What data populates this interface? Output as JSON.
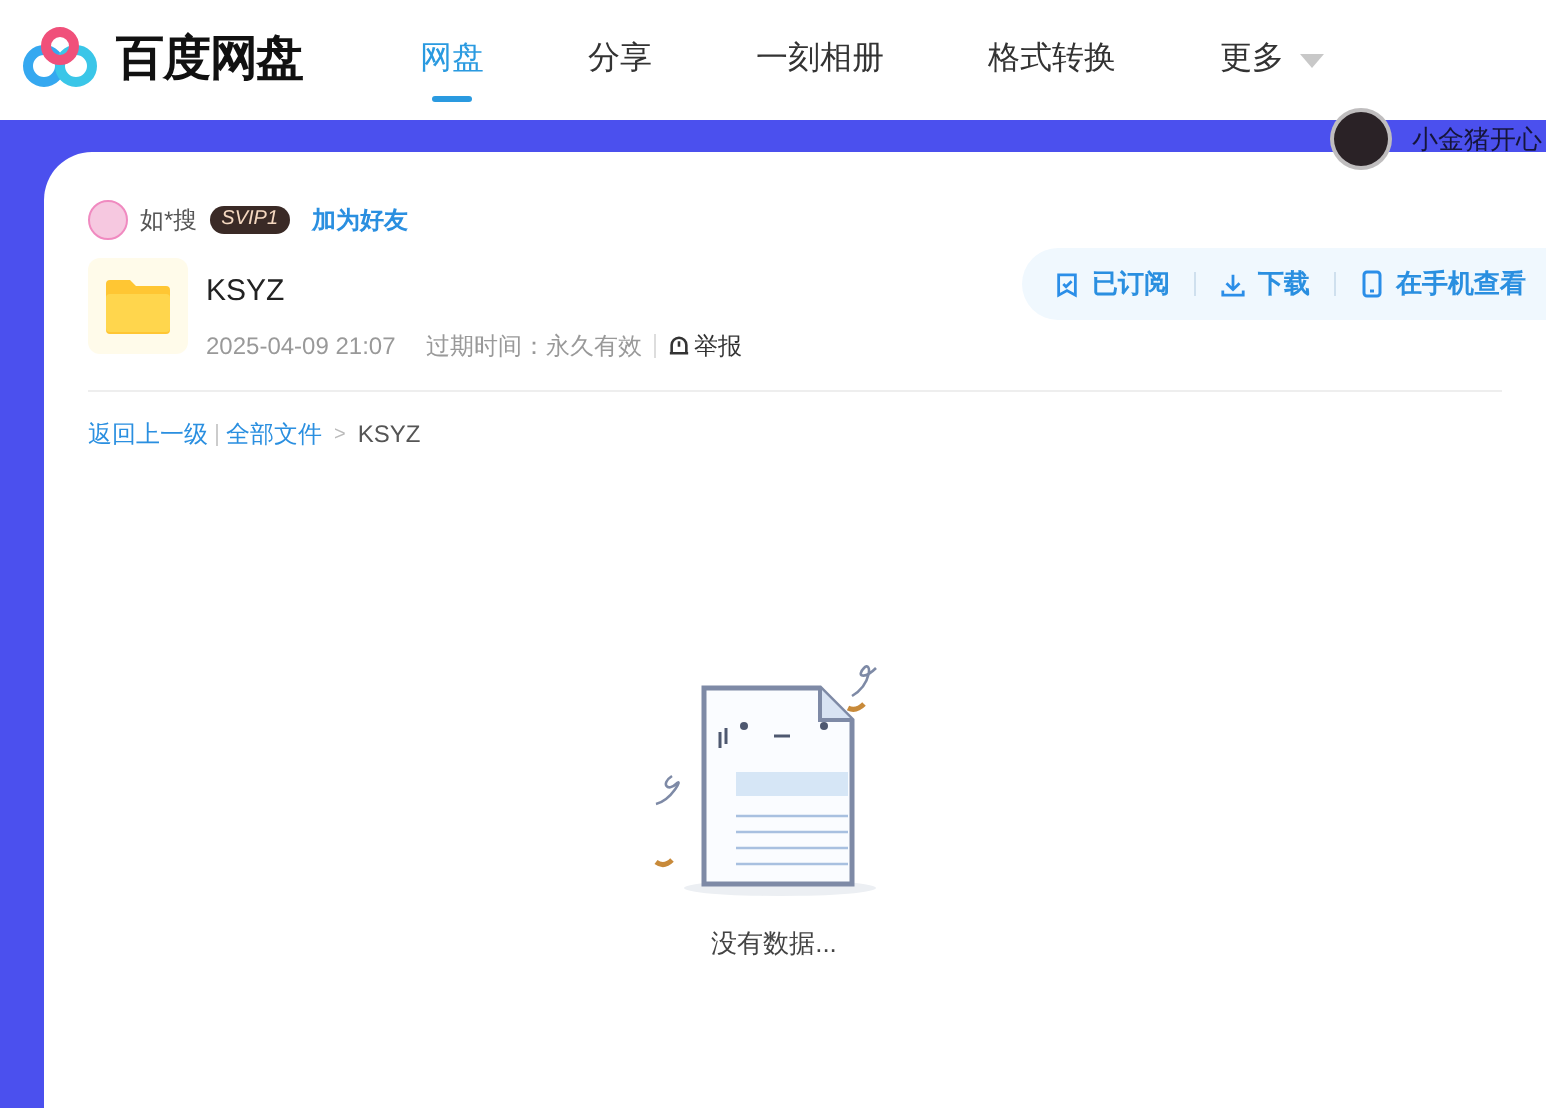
{
  "header": {
    "logo_text": "百度网盘",
    "tabs": [
      {
        "label": "网盘",
        "selected": true
      },
      {
        "label": "分享",
        "selected": false
      },
      {
        "label": "一刻相册",
        "selected": false
      },
      {
        "label": "格式转换",
        "selected": false
      },
      {
        "label": "更多",
        "selected": false,
        "dropdown": true
      }
    ],
    "user_name": "小金猪开心"
  },
  "share": {
    "owner": {
      "name": "如*搜",
      "badge": "SVIP1",
      "add_friend": "加为好友"
    },
    "file": {
      "name": "KSYZ",
      "date": "2025-04-09 21:07",
      "expiry_label": "过期时间：",
      "expiry": "永久有效",
      "report": "举报"
    },
    "actions": [
      {
        "kind": "subscribe",
        "label": "已订阅"
      },
      {
        "kind": "download",
        "label": "下载"
      },
      {
        "kind": "phone",
        "label": "在手机查看"
      }
    ]
  },
  "breadcrumb": {
    "back": "返回上一级",
    "separator": ">",
    "items": [
      {
        "label": "全部文件",
        "link": true
      },
      {
        "label": "KSYZ",
        "link": false
      }
    ]
  },
  "empty_state": {
    "message": "没有数据..."
  }
}
